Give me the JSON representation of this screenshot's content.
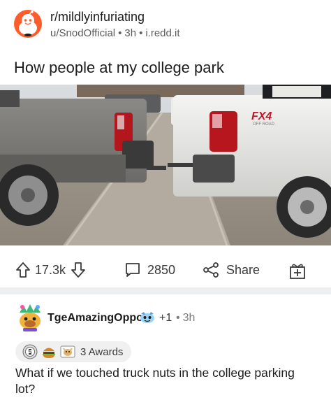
{
  "post": {
    "subreddit": "r/mildlyinfuriating",
    "author": "u/SnodOfficial",
    "age": "3h",
    "domain": "i.redd.it",
    "title": "How people at my college park",
    "subreddit_icon": "reddit-snoo-icon",
    "image_brand_text": "FX4",
    "image_badge_text": "OFF ROAD"
  },
  "actions": {
    "score": "17.3k",
    "comments": "2850",
    "share_label": "Share",
    "icons": [
      "upvote-icon",
      "downvote-icon",
      "comment-icon",
      "share-icon",
      "give-award-icon"
    ]
  },
  "comment": {
    "username": "TgeAmazingOppo",
    "karma_delta": "+1",
    "age": "3h",
    "awards_label": "3 Awards",
    "body": "What if we touched truck nuts in the college parking lot?"
  },
  "colors": {
    "subreddit_icon_bg": "#ff5c2b",
    "divider": "#edeff1",
    "awards_pill_bg": "#f0f0f0",
    "text_primary": "#1c1c1c",
    "text_meta": "#5c5c5c"
  }
}
